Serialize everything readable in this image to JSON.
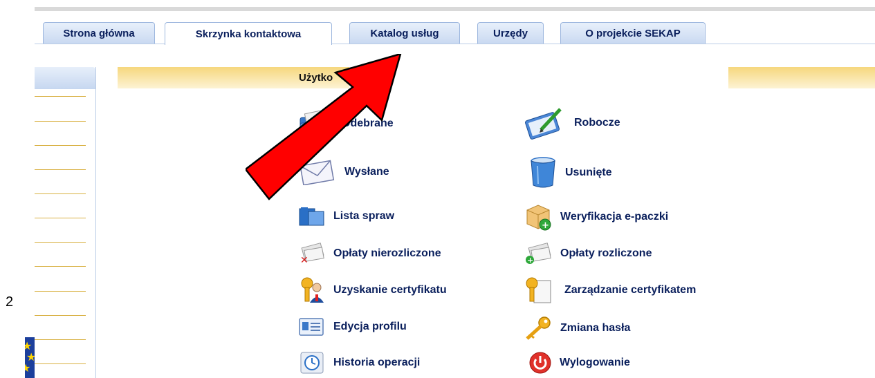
{
  "tabs": [
    {
      "label": "Strona główna",
      "active": false
    },
    {
      "label": "Skrzynka kontaktowa",
      "active": true
    },
    {
      "label": "Katalog usług",
      "active": false
    },
    {
      "label": "Urzędy",
      "active": false
    },
    {
      "label": "O projekcie SEKAP",
      "active": false
    }
  ],
  "header": {
    "title": "Użytko"
  },
  "page_number": "2",
  "menu": {
    "left": [
      {
        "label": "Odebrane",
        "icon": "inbox-folder-icon"
      },
      {
        "label": "Wysłane",
        "icon": "envelope-icon"
      },
      {
        "label": "Lista spraw",
        "icon": "case-list-icon"
      },
      {
        "label": "Opłaty nierozliczone",
        "icon": "unpaid-fees-icon"
      },
      {
        "label": "Uzyskanie certyfikatu",
        "icon": "certificate-request-icon"
      },
      {
        "label": "Edycja profilu",
        "icon": "profile-card-icon"
      },
      {
        "label": "Historia operacji",
        "icon": "clock-icon"
      }
    ],
    "right": [
      {
        "label": "Robocze",
        "icon": "drafts-pencil-icon"
      },
      {
        "label": "Usunięte",
        "icon": "trash-bin-icon"
      },
      {
        "label": "Weryfikacja e-paczki",
        "icon": "package-verify-icon"
      },
      {
        "label": "Opłaty rozliczone",
        "icon": "paid-fees-icon"
      },
      {
        "label": "Zarządzanie certyfikatem",
        "icon": "certificate-key-icon"
      },
      {
        "label": "Zmiana hasła",
        "icon": "key-icon"
      },
      {
        "label": "Wylogowanie",
        "icon": "power-icon"
      }
    ]
  },
  "colors": {
    "link": "#0a1f5c",
    "arrow": "#ff0000",
    "header_gradient_top": "#f6d77d",
    "tab_border": "#9cb6de"
  }
}
